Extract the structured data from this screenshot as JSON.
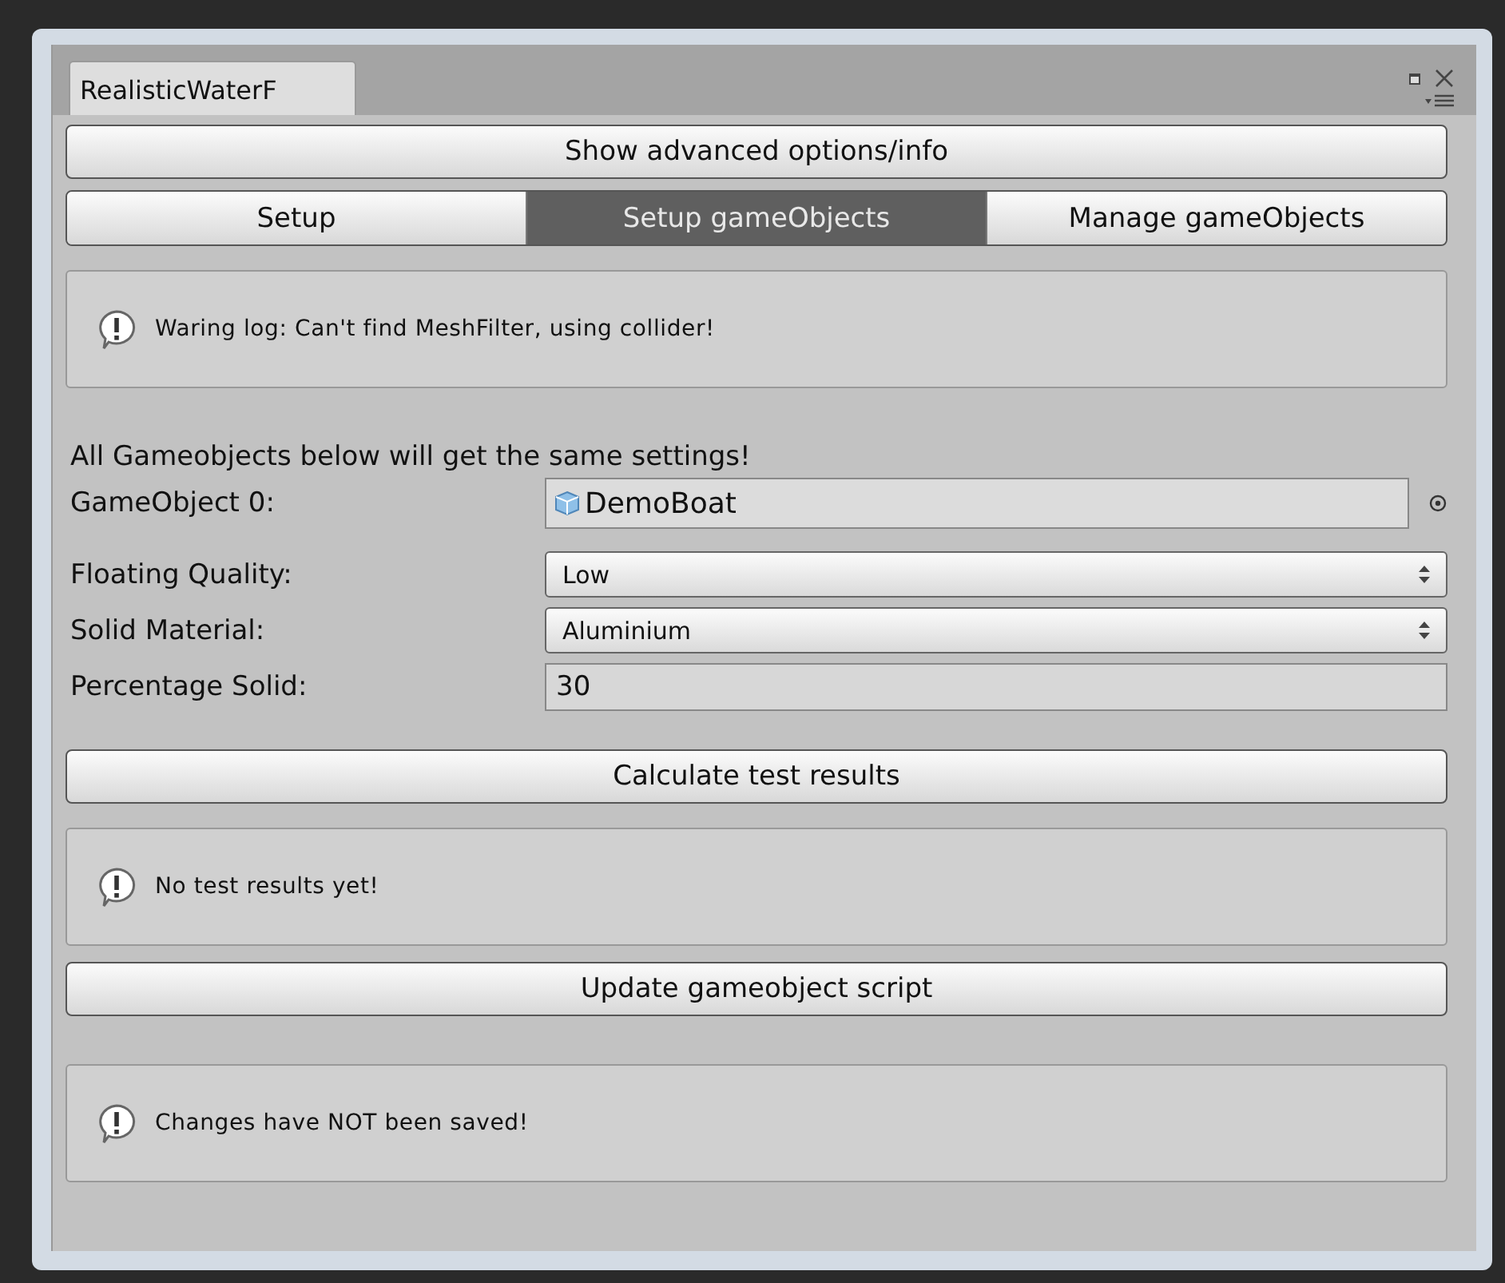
{
  "window": {
    "tab_title": "RealisticWaterF"
  },
  "advanced_button": "Show advanced options/info",
  "tabs": [
    {
      "label": "Setup",
      "selected": false
    },
    {
      "label": "Setup gameObjects",
      "selected": true
    },
    {
      "label": "Manage gameObjects",
      "selected": false
    }
  ],
  "warning": "Waring log: Can't find MeshFilter, using collider!",
  "intro": "All Gameobjects below will get the same settings!",
  "fields": [
    {
      "kind": "object",
      "label": "GameObject 0:",
      "value": "DemoBoat"
    },
    {
      "kind": "dropdown",
      "label": "Floating Quality:",
      "value": "Low"
    },
    {
      "kind": "dropdown",
      "label": "Solid Material:",
      "value": "Aluminium"
    },
    {
      "kind": "number",
      "label": "Percentage Solid:",
      "value": "30"
    }
  ],
  "calculate_button": "Calculate test results",
  "results_message": "No test results yet!",
  "update_button": "Update gameobject script",
  "save_message": "Changes have NOT been saved!"
}
